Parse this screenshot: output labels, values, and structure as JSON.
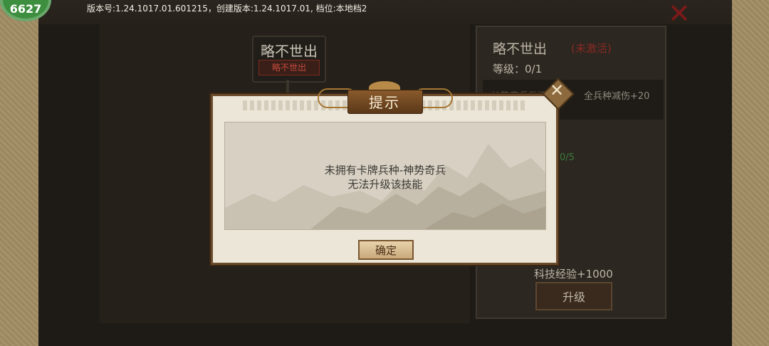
{
  "badge": {
    "value": "6627"
  },
  "header": {
    "version_info": "版本号:1.24.1017.01.601215，创建版本:1.24.1017.01, 档位:本地档2"
  },
  "skill_node": {
    "title": "略不世出",
    "tag": "略不世出"
  },
  "info_panel": {
    "title": "略不世出",
    "status": "(未激活)",
    "level": "等级：0/1",
    "effect_left": "神势奇兵升级",
    "effect_right": "全兵种减伤+20",
    "progress": "0/5",
    "exp_reward": "科技经验+1000",
    "upgrade_label": "升级"
  },
  "dialog": {
    "title": "提示",
    "message_line1": "未拥有卡牌兵种-神势奇兵",
    "message_line2": "无法升级该技能",
    "confirm_label": "确定",
    "close_icon": "close-icon"
  },
  "colors": {
    "accent_red": "#8a2a22",
    "dialog_frame": "#6b4b2b",
    "badge_green": "#3e8e3f"
  }
}
